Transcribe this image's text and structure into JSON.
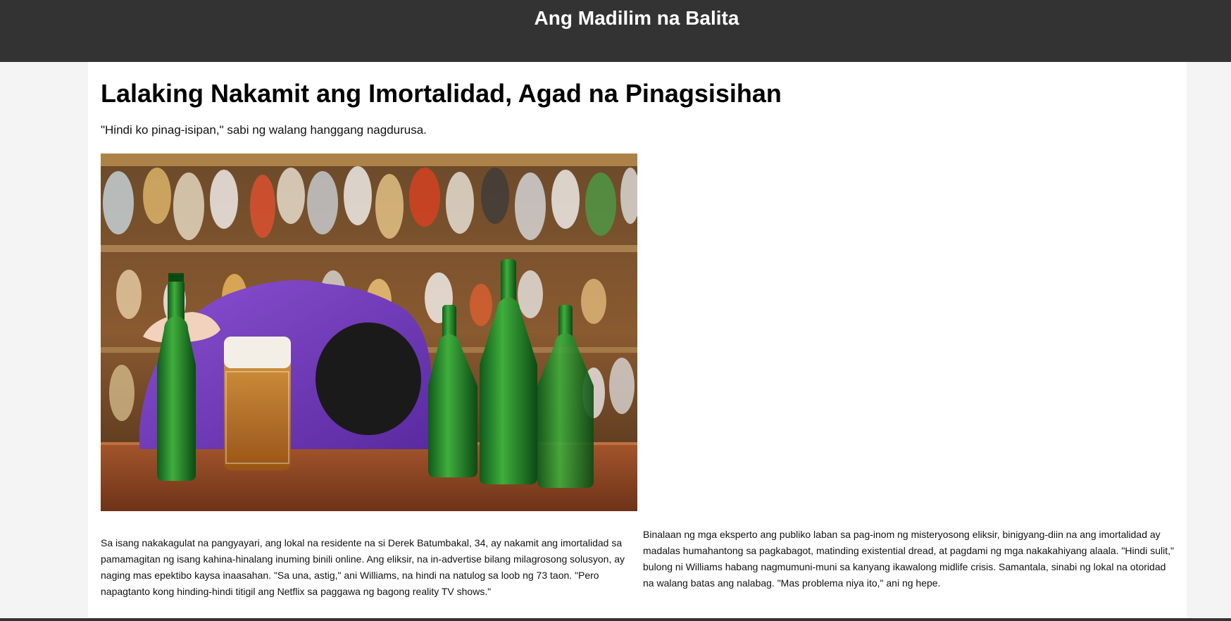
{
  "site": {
    "title": "Ang Madilim na Balita"
  },
  "article": {
    "headline": "Lalaking Nakamit ang Imortalidad, Agad na Pinagsisihan",
    "subhead": "\"Hindi ko pinag-isipan,\" sabi ng walang hanggang nagdurusa.",
    "paragraphs": [
      "Sa isang nakakagulat na pangyayari, ang lokal na residente na si Derek Batumbakal, 34, ay nakamit ang imortalidad sa pamamagitan ng isang kahina-hinalang inuming binili online. Ang eliksir, na in-advertise bilang milagrosong solusyon, ay naging mas epektibo kaysa inaasahan. \"Sa una, astig,\" ani Williams, na hindi na natulog sa loob ng 73 taon. \"Pero napagtanto kong hinding-hindi titigil ang Netflix sa paggawa ng bagong reality TV shows.\"",
      "Binalaan ng mga eksperto ang publiko laban sa pag-inom ng misteryosong eliksir, binigyang-diin na ang imortalidad ay madalas humahantong sa pagkabagot, matinding existential dread, at pagdami ng mga nakakahiyang alaala. \"Hindi sulit,\" bulong ni Williams habang nagmumuni-muni sa kanyang ikawalong midlife crisis. Samantala, sinabi ng lokal na otoridad na walang batas ang nalabag. \"Mas problema niya ito,\" ani ng hepe."
    ]
  },
  "colors": {
    "header_bg": "#333333",
    "page_bg": "#f4f4f4",
    "article_bg": "#ffffff",
    "header_text": "#ffffff"
  }
}
